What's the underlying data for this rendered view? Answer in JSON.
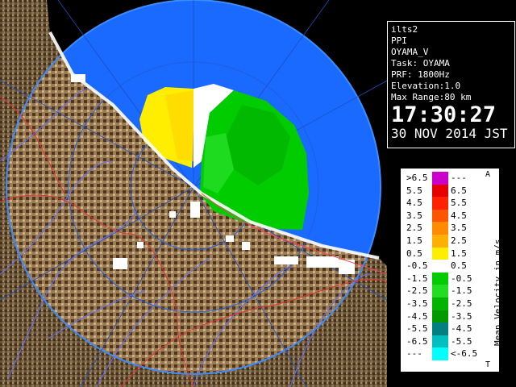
{
  "info": {
    "source": "ilts2",
    "product": "PPI",
    "site": "OYAMA_V",
    "task": "Task: OYAMA",
    "prf": "PRF: 1800Hz",
    "elevation": "Elevation:1.0",
    "max_range": "Max Range:80 km",
    "time": "17:30:27",
    "date": "30 NOV 2014 JST"
  },
  "legend": {
    "title": "Mean Velocity in m/s",
    "top_marker": "A",
    "bottom_marker": "T",
    "rows": [
      {
        "lo": ">6.5",
        "hi": "---",
        "color": "#cc00cc"
      },
      {
        "lo": "5.5",
        "hi": "6.5",
        "color": "#e60000"
      },
      {
        "lo": "4.5",
        "hi": "5.5",
        "color": "#ff2200"
      },
      {
        "lo": "3.5",
        "hi": "4.5",
        "color": "#ff5500"
      },
      {
        "lo": "2.5",
        "hi": "3.5",
        "color": "#ff8c00"
      },
      {
        "lo": "1.5",
        "hi": "2.5",
        "color": "#ffb000"
      },
      {
        "lo": "0.5",
        "hi": "1.5",
        "color": "#ffee00"
      },
      {
        "lo": "-0.5",
        "hi": "0.5",
        "color": "#ffffff"
      },
      {
        "lo": "-1.5",
        "hi": "-0.5",
        "color": "#00cc00"
      },
      {
        "lo": "-2.5",
        "hi": "-1.5",
        "color": "#22dd22"
      },
      {
        "lo": "-3.5",
        "hi": "-2.5",
        "color": "#00b400"
      },
      {
        "lo": "-4.5",
        "hi": "-3.5",
        "color": "#009900"
      },
      {
        "lo": "-5.5",
        "hi": "-4.5",
        "color": "#008080"
      },
      {
        "lo": "-6.5",
        "hi": "-5.5",
        "color": "#00bfbf"
      },
      {
        "lo": "---",
        "hi": "<-6.5",
        "color": "#00ffff"
      }
    ]
  },
  "colors": {
    "sea": "#1a6aff",
    "range_ring": "#3c8cff",
    "terrain": "#8a6a44",
    "terrain_light": "#c8b48c",
    "river": "#6070ff",
    "border": "#e03030",
    "approach": "#ff3b7a",
    "recede": "#22cc22"
  }
}
